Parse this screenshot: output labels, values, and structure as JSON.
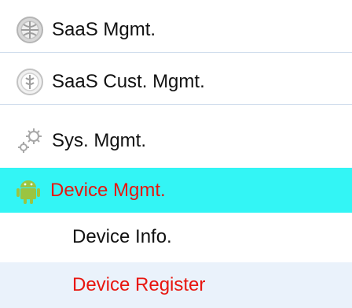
{
  "menu": {
    "items": [
      {
        "label": "SaaS Mgmt.",
        "icon": "saas-globe-icon"
      },
      {
        "label": "SaaS Cust. Mgmt.",
        "icon": "customer-circle-icon"
      },
      {
        "label": "Sys. Mgmt.",
        "icon": "gears-icon"
      },
      {
        "label": "Device Mgmt.",
        "icon": "android-icon",
        "active": true
      }
    ],
    "subitems": [
      {
        "label": "Device Info."
      },
      {
        "label": "Device Register",
        "active": true
      }
    ]
  },
  "colors": {
    "active_bg": "#33f5f5",
    "active_text": "#e8160f",
    "selected_sub_bg": "#eaf2fb",
    "divider": "#cfdcec",
    "android_green": "#9bc441"
  }
}
